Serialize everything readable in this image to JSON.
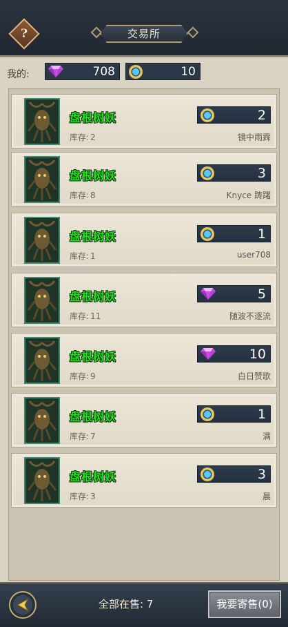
{
  "header": {
    "title": "交易所",
    "help_icon": "?"
  },
  "wallet": {
    "label": "我的:",
    "gems": "708",
    "coins": "10"
  },
  "colors": {
    "name_green": "#23e01d",
    "panel_dark": "#2b3746",
    "parchment": "#d9d3c3"
  },
  "listings": [
    {
      "name": "盘根树妖",
      "stock_label": "库存:",
      "stock": "2",
      "currency": "coin",
      "price": "2",
      "seller": "镜中雨霖"
    },
    {
      "name": "盘根树妖",
      "stock_label": "库存:",
      "stock": "8",
      "currency": "coin",
      "price": "3",
      "seller": "Knyce 踌躇"
    },
    {
      "name": "盘根树妖",
      "stock_label": "库存:",
      "stock": "1",
      "currency": "coin",
      "price": "1",
      "seller": "user708"
    },
    {
      "name": "盘根树妖",
      "stock_label": "库存:",
      "stock": "11",
      "currency": "gem",
      "price": "5",
      "seller": "随波不逐流"
    },
    {
      "name": "盘根树妖",
      "stock_label": "库存:",
      "stock": "9",
      "currency": "gem",
      "price": "10",
      "seller": "白日赞歌"
    },
    {
      "name": "盘根树妖",
      "stock_label": "库存:",
      "stock": "7",
      "currency": "coin",
      "price": "1",
      "seller": "满"
    },
    {
      "name": "盘根树妖",
      "stock_label": "库存:",
      "stock": "3",
      "currency": "coin",
      "price": "3",
      "seller": "晨"
    }
  ],
  "footer": {
    "total_label": "全部在售:",
    "total": "7",
    "sell_button": "我要寄售(0)"
  }
}
